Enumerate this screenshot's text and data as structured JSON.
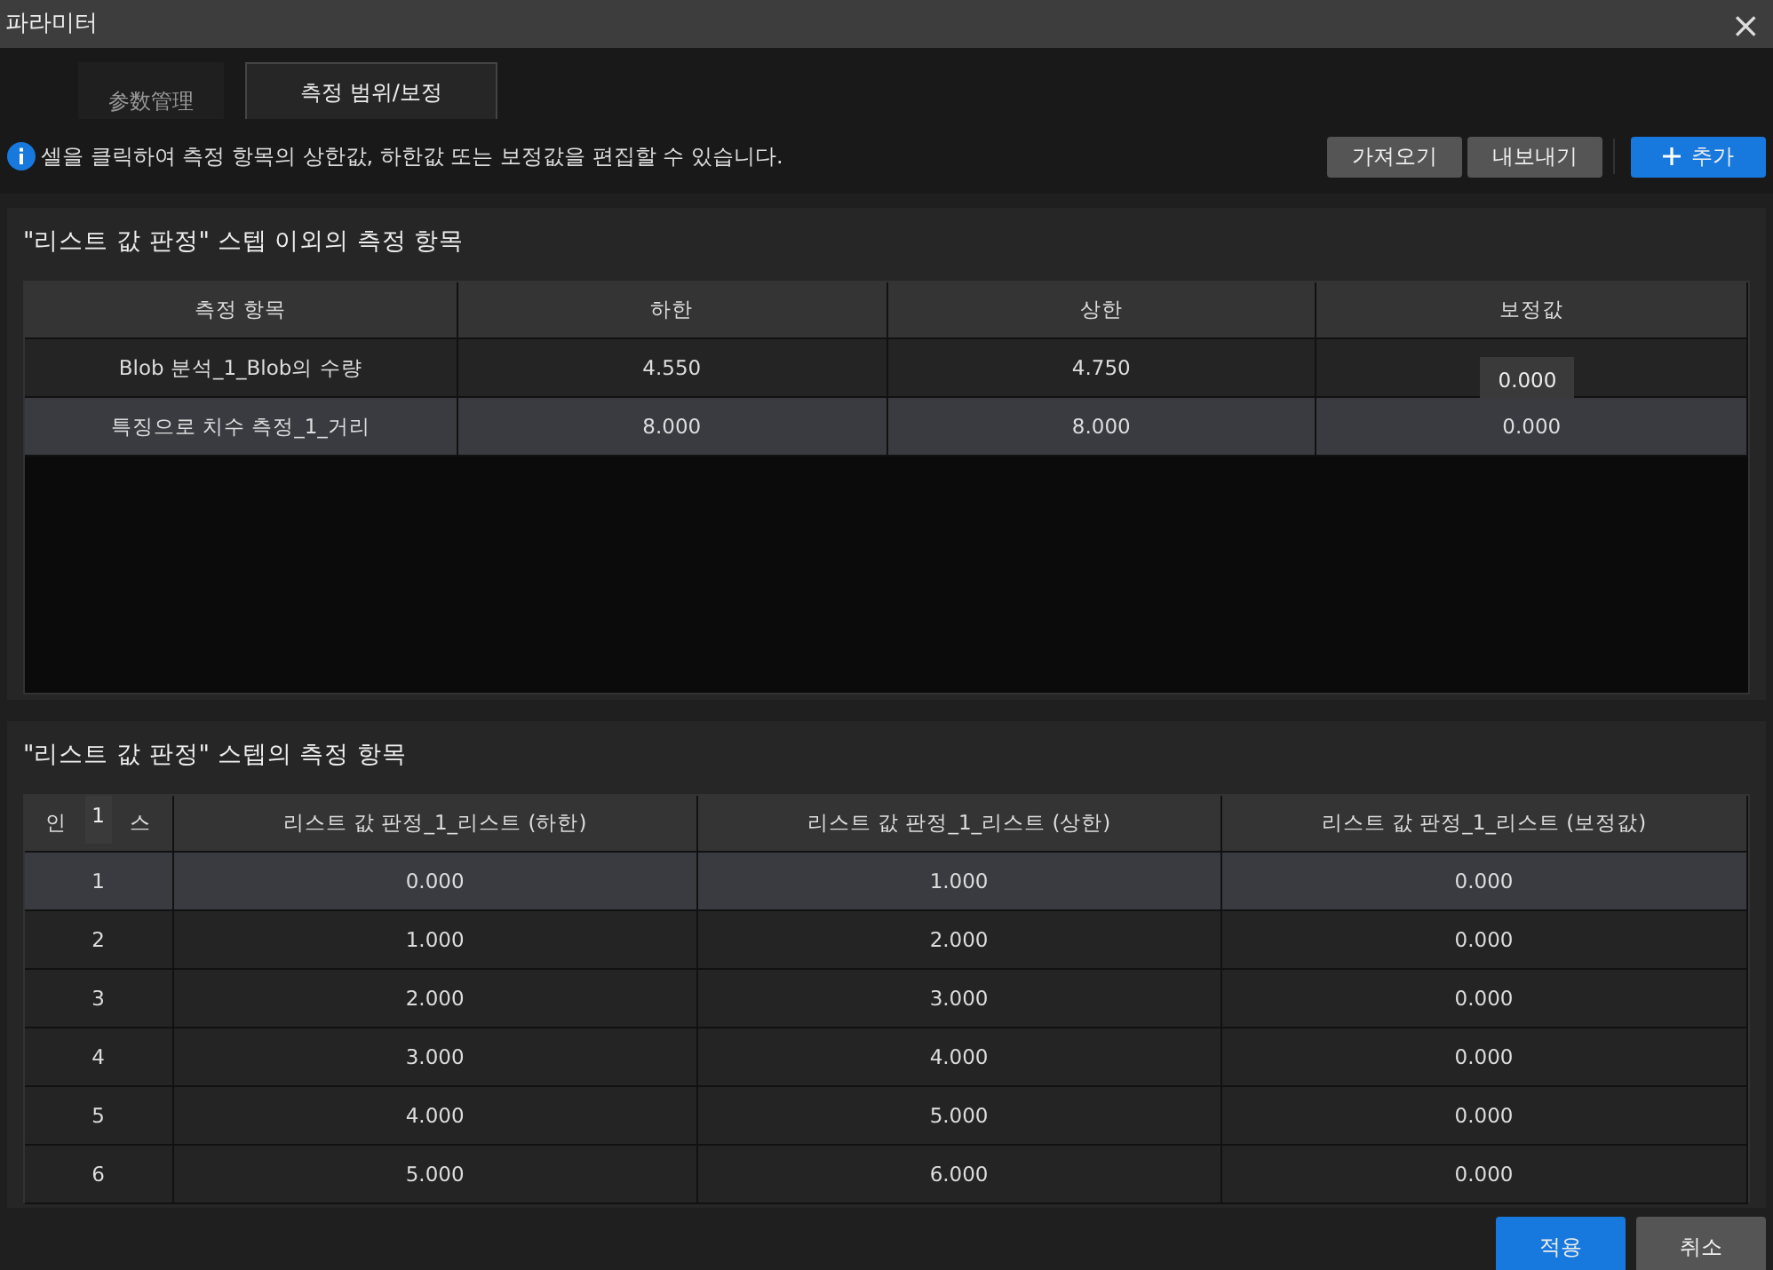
{
  "window": {
    "title": "파라미터",
    "close": "×"
  },
  "tabs": [
    {
      "label": "参数管理",
      "selected": false
    },
    {
      "label": "측정 범위/보정",
      "selected": true
    }
  ],
  "info": "셀을 클릭하여 측정 항목의 상한값, 하한값 또는 보정값을 편집할 수 있습니다.",
  "toolbar": [
    {
      "label": "가져오기",
      "kind": "plain"
    },
    {
      "label": "내보내기",
      "kind": "plain"
    },
    {
      "label": "추가",
      "kind": "add"
    }
  ],
  "section_1": {
    "title": "\"리스트 값 판정\" 스텝 이외의 측정 항목",
    "columns": [
      "측정 항목",
      "하한",
      "상한",
      "보정값"
    ],
    "rows": [
      {
        "selected": false,
        "tooltip": "0.000",
        "cells": [
          "Blob 분석_1_Blob의 수량",
          "4.550",
          "4.750",
          ""
        ]
      },
      {
        "selected": true,
        "cells": [
          "특징으로 치수 측정_1_거리",
          "8.000",
          "8.000",
          "0.000"
        ]
      }
    ]
  },
  "section_2": {
    "title": "\"리스트 값 판정\" 스텝의 측정 항목",
    "columns": [
      "인",
      "리스트 값 판정_1_리스트 (하한)",
      "리스트 값 판정_1_리스트 (상한)",
      "리스트 값 판정_1_리스트 (보정값)"
    ],
    "header_tooltip": "1",
    "header_tail": "스",
    "rows": [
      {
        "selected": true,
        "cells": [
          "1",
          "0.000",
          "1.000",
          "0.000"
        ]
      },
      {
        "selected": false,
        "cells": [
          "2",
          "1.000",
          "2.000",
          "0.000"
        ]
      },
      {
        "selected": false,
        "cells": [
          "3",
          "2.000",
          "3.000",
          "0.000"
        ]
      },
      {
        "selected": false,
        "cells": [
          "4",
          "3.000",
          "4.000",
          "0.000"
        ]
      },
      {
        "selected": false,
        "cells": [
          "5",
          "4.000",
          "5.000",
          "0.000"
        ]
      },
      {
        "selected": false,
        "cells": [
          "6",
          "5.000",
          "6.000",
          "0.000"
        ]
      }
    ]
  },
  "footer": [
    {
      "label": "적용",
      "kind": "primary"
    },
    {
      "label": "취소",
      "kind": "plain"
    }
  ]
}
